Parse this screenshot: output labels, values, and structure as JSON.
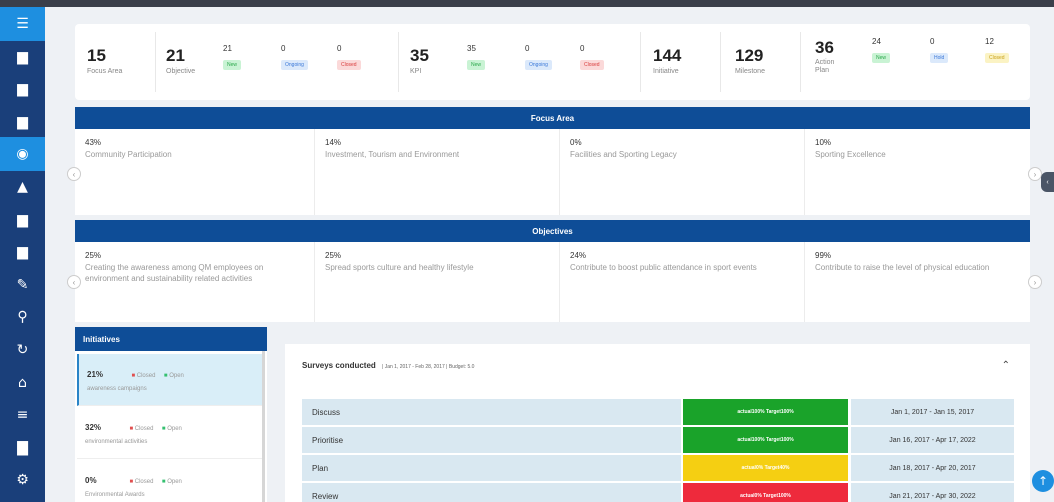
{
  "sidebar": {
    "items": [
      {
        "icon": "menu-icon",
        "glyph": "☰"
      },
      {
        "icon": "document-icon",
        "glyph": "▆"
      },
      {
        "icon": "file-icon",
        "glyph": "▆"
      },
      {
        "icon": "folder-icon",
        "glyph": "▆"
      },
      {
        "icon": "target-icon",
        "glyph": "◉"
      },
      {
        "icon": "warning-icon",
        "glyph": "▲"
      },
      {
        "icon": "book-icon",
        "glyph": "▆"
      },
      {
        "icon": "briefcase-icon",
        "glyph": "▆"
      },
      {
        "icon": "edit-icon",
        "glyph": "✎"
      },
      {
        "icon": "search-icon",
        "glyph": "⚲"
      },
      {
        "icon": "refresh-icon",
        "glyph": "↻"
      },
      {
        "icon": "home-icon",
        "glyph": "⌂"
      },
      {
        "icon": "list-icon",
        "glyph": "≡"
      },
      {
        "icon": "lock-icon",
        "glyph": "▇"
      },
      {
        "icon": "settings-icon",
        "glyph": "⚙"
      }
    ]
  },
  "stats": {
    "focus": {
      "num": "15",
      "label": "Focus Area"
    },
    "objective": {
      "num": "21",
      "label": "Objective",
      "subs": [
        {
          "n": "21",
          "badge": "New"
        },
        {
          "n": "0",
          "badge": "Ongoing"
        },
        {
          "n": "0",
          "badge": "Closed"
        }
      ]
    },
    "kpi": {
      "num": "35",
      "label": "KPI",
      "subs": [
        {
          "n": "35",
          "badge": "New"
        },
        {
          "n": "0",
          "badge": "Ongoing"
        },
        {
          "n": "0",
          "badge": "Closed"
        }
      ]
    },
    "initiative": {
      "num": "144",
      "label": "Initiative"
    },
    "milestone": {
      "num": "129",
      "label": "Milestone"
    },
    "action": {
      "num": "36",
      "label": "Action Plan",
      "subs": [
        {
          "n": "24",
          "badge": "New"
        },
        {
          "n": "0",
          "badge": "Hold"
        },
        {
          "n": "12",
          "badge": "Closed"
        }
      ]
    }
  },
  "focus_area": {
    "title": "Focus Area",
    "cards": [
      {
        "pct": "43%",
        "text": "Community Participation"
      },
      {
        "pct": "14%",
        "text": "Investment, Tourism and Environment"
      },
      {
        "pct": "0%",
        "text": "Facilities and Sporting Legacy"
      },
      {
        "pct": "10%",
        "text": "Sporting Excellence"
      }
    ]
  },
  "objectives": {
    "title": "Objectives",
    "cards": [
      {
        "pct": "25%",
        "text": "Creating the awareness among QM employees on environment and sustainability related activities"
      },
      {
        "pct": "25%",
        "text": "Spread sports culture and healthy lifestyle"
      },
      {
        "pct": "24%",
        "text": "Contribute to boost public attendance in sport events"
      },
      {
        "pct": "99%",
        "text": "Contribute to raise the level of physical education"
      }
    ]
  },
  "initiatives": {
    "title": "Initiatives",
    "closed_label": "Closed",
    "open_label": "Open",
    "items": [
      {
        "pct": "21%",
        "text": "awareness campaigns"
      },
      {
        "pct": "32%",
        "text": "environmental activities"
      },
      {
        "pct": "0%",
        "text": "Environmental Awards"
      }
    ]
  },
  "survey": {
    "title": "Surveys conducted",
    "meta": "| Jan 1, 2017 - Feb 28, 2017 | Budget: 5.0",
    "rows": [
      {
        "name": "Discuss",
        "bar": "actual100%  Target100%",
        "color": "#1aa32a",
        "dates": "Jan 1, 2017 - Jan 15, 2017"
      },
      {
        "name": "Prioritise",
        "bar": "actual100%  Target100%",
        "color": "#1aa32a",
        "dates": "Jan 16, 2017 - Apr 17, 2022"
      },
      {
        "name": "Plan",
        "bar": "actual0%  Target40%",
        "color": "#f5cf12",
        "dates": "Jan 18, 2017 - Apr 20, 2017"
      },
      {
        "name": "Review",
        "bar": "actual0%  Target100%",
        "color": "#ee2a3c",
        "dates": "Jan 21, 2017 - Apr 30, 2022"
      }
    ]
  }
}
